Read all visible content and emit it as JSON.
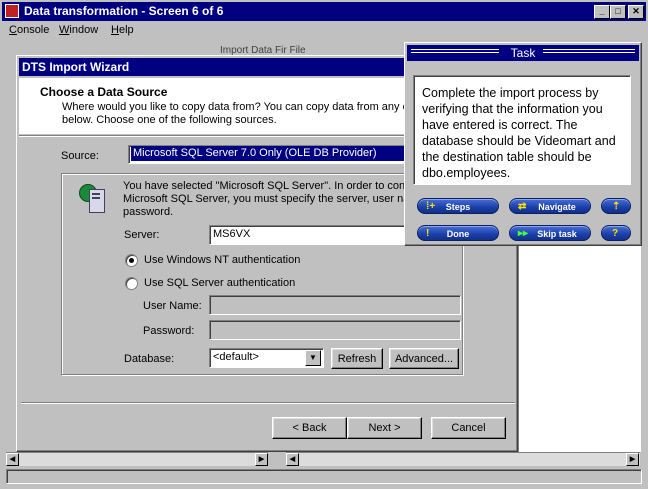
{
  "window": {
    "title": "Data transformation - Screen 6 of 6"
  },
  "menu": [
    "Console",
    "Window",
    "Help"
  ],
  "background_text": "Import Data Fir File",
  "wizard": {
    "title": "DTS Import Wizard",
    "header_title": "Choose a Data Source",
    "header_desc_1": "Where would you like to copy data from?  You can copy data from any o",
    "header_desc_2": "below.  Choose one of the following sources.",
    "source_label": "Source:",
    "source_value": "Microsoft SQL Server 7.0 Only (OLE DB Provider)",
    "info_1": "You have selected \"Microsoft SQL Server\". In order to con",
    "info_2": "Microsoft SQL Server, you must specify the server, user nar",
    "info_3": "password.",
    "server_label": "Server:",
    "server_value": "MS6VX",
    "auth_nt": "Use Windows NT authentication",
    "auth_sql": "Use SQL Server authentication",
    "auth_selected": "nt",
    "username_label": "User Name:",
    "username_value": "",
    "password_label": "Password:",
    "password_value": "",
    "database_label": "Database:",
    "database_value": "<default>",
    "refresh": "Refresh",
    "advanced": "Advanced...",
    "back": "< Back",
    "next": "Next >",
    "cancel": "Cancel"
  },
  "task": {
    "title": "Task",
    "text": "Complete the import process by verifying that the information you have entered is correct.  The database should be Videomart and the destination table should be dbo.employees.",
    "steps": "Steps",
    "navigate": "Navigate",
    "done": "Done",
    "skip": "Skip task",
    "up_icon": "up-arrow-icon",
    "help_icon": "question-icon"
  },
  "colors": {
    "title_bar": "#000080",
    "task_buttons": "#1a3fa8"
  }
}
